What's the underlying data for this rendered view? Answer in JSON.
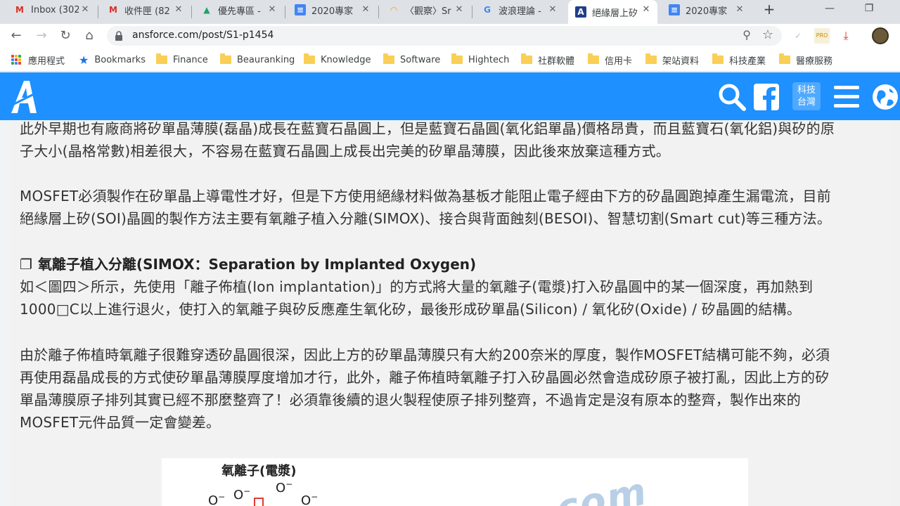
{
  "tabs": [
    {
      "title": "Inbox (302",
      "icon": "gmail-icon",
      "active": false
    },
    {
      "title": "收件匣 (82",
      "icon": "gmail-icon",
      "active": false
    },
    {
      "title": "優先專區 -",
      "icon": "drive-icon",
      "active": false
    },
    {
      "title": "2020專家",
      "icon": "docs-icon",
      "active": false
    },
    {
      "title": "〈觀察〉Sr",
      "icon": "rainbow-icon",
      "active": false
    },
    {
      "title": "波浪理論 -",
      "icon": "google-icon",
      "active": false
    },
    {
      "title": "絕緣層上矽",
      "icon": "ansforce-icon",
      "active": true
    },
    {
      "title": "2020專家",
      "icon": "docs-icon",
      "active": false
    }
  ],
  "new_tab_label": "+",
  "url": "ansforce.com/post/S1-p1454",
  "bookmarks": [
    {
      "label": "應用程式",
      "type": "apps"
    },
    {
      "label": "Bookmarks",
      "type": "star"
    },
    {
      "label": "Finance",
      "type": "folder"
    },
    {
      "label": "Beauranking",
      "type": "folder"
    },
    {
      "label": "Knowledge",
      "type": "folder"
    },
    {
      "label": "Software",
      "type": "folder"
    },
    {
      "label": "Hightech",
      "type": "folder"
    },
    {
      "label": "社群軟體",
      "type": "folder"
    },
    {
      "label": "信用卡",
      "type": "folder"
    },
    {
      "label": "架站資料",
      "type": "folder"
    },
    {
      "label": "科技產業",
      "type": "folder"
    },
    {
      "label": "醫療服務",
      "type": "folder"
    }
  ],
  "site": {
    "logo_letter": "A",
    "lang_badge_line1": "科技",
    "lang_badge_line2": "台灣",
    "brand_color": "#1e90ff"
  },
  "article": {
    "p1_line1": "此外早期也有廠商將矽單晶薄膜(磊晶)成長在藍寶石晶圓上，但是藍寶石晶圓(氧化鋁單晶)價格昂貴，而且藍寶石(氧化鋁)與矽的原",
    "p1_line2": "子大小(晶格常數)相差很大，不容易在藍寶石晶圓上成長出完美的矽單晶薄膜，因此後來放棄這種方式。",
    "p2_line1": "MOSFET必須製作在矽單晶上導電性才好，但是下方使用絕緣材料做為基板才能阻止電子經由下方的矽晶圓跑掉產生漏電流，目前",
    "p2_line2": "絕緣層上矽(SOI)晶圓的製作方法主要有氧離子植入分離(SIMOX)、接合與背面蝕刻(BESOI)、智慧切割(Smart cut)等三種方法。",
    "heading_box": "❐",
    "heading": "氧離子植入分離(SIMOX：Separation by Implanted Oxygen)",
    "p3_line1": "如＜圖四＞所示，先使用「離子佈植(Ion implantation)」的方式將大量的氧離子(電漿)打入矽晶圓中的某一個深度，再加熱到",
    "p3_line2": "1000□C以上進行退火，使打入的氧離子與矽反應產生氧化矽，最後形成矽單晶(Silicon) / 氧化矽(Oxide) / 矽晶圓的結構。",
    "p4_line1": "由於離子佈植時氧離子很難穿透矽晶圓很深，因此上方的矽單晶薄膜只有大約200奈米的厚度，製作MOSFET結構可能不夠，必須",
    "p4_line2": "再使用磊晶成長的方式使矽單晶薄膜厚度增加才行，此外，離子佈植時氧離子打入矽晶圓必然會造成矽原子被打亂，因此上方的矽",
    "p4_line3": "單晶薄膜原子排列其實已經不那麼整齊了！必須靠後續的退火製程使原子排列整齊，不過肯定是沒有原本的整齊，製作出來的",
    "p4_line4": "MOSFET元件品質一定會變差。"
  },
  "figure": {
    "caption": "氧離子(電漿)",
    "ion_label": "O",
    "ion_charge": "−",
    "watermark": "com"
  }
}
